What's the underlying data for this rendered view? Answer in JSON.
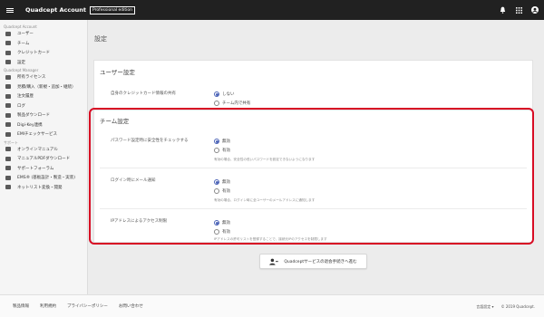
{
  "topbar": {
    "title": "Quadcept Account",
    "edition": "Professional edition",
    "icons": [
      "menu-icon",
      "bell-icon",
      "apps-grid-icon",
      "account-icon"
    ]
  },
  "sidebar": {
    "sections": [
      {
        "title": "Quadcept Account",
        "items": [
          {
            "label": "ユーザー",
            "icon": "users-icon"
          },
          {
            "label": "チーム",
            "icon": "team-icon"
          },
          {
            "label": "クレジットカード",
            "icon": "credit-card-icon"
          },
          {
            "label": "設定",
            "icon": "gear-icon"
          }
        ]
      },
      {
        "title": "Quadcept Manager",
        "items": [
          {
            "label": "所有ライセンス",
            "icon": "license-icon"
          },
          {
            "label": "見積/購入（新規・追加・継続）",
            "icon": "cart-icon"
          },
          {
            "label": "注文履歴",
            "icon": "history-icon"
          },
          {
            "label": "ログ",
            "icon": "chart-icon"
          },
          {
            "label": "製品ダウンロード",
            "icon": "cloud-download-icon"
          },
          {
            "label": "Digi-Key連携",
            "icon": "cart-icon"
          },
          {
            "label": "EMIチェックサービス",
            "icon": "emi-icon"
          }
        ]
      },
      {
        "title": "サポート",
        "items": [
          {
            "label": "オンラインマニュアル",
            "icon": "book-icon"
          },
          {
            "label": "マニュアルPDFダウンロード",
            "icon": "pdf-icon"
          },
          {
            "label": "サポートフォーラム",
            "icon": "forum-icon"
          },
          {
            "label": "EMS® (基板設計・製造・実装)",
            "icon": "ems-icon"
          },
          {
            "label": "ネットリスト変換・開発",
            "icon": "netlist-icon"
          }
        ]
      }
    ]
  },
  "main": {
    "page_title": "設定",
    "user_settings": {
      "title": "ユーザー設定",
      "rows": [
        {
          "label": "自身のクレジットカード情報の共有",
          "options": [
            {
              "label": "しない",
              "selected": true
            },
            {
              "label": "チーム内で共有",
              "selected": false
            }
          ]
        }
      ]
    },
    "team_settings": {
      "title": "チーム設定",
      "rows": [
        {
          "label": "パスワード設定時に安全性をチェックする",
          "options": [
            {
              "label": "無効",
              "selected": true
            },
            {
              "label": "有効",
              "selected": false
            }
          ],
          "hint": "有効の場合、安全性の低いパスワードを設定できないようになります"
        },
        {
          "label": "ログイン時にメール通知",
          "options": [
            {
              "label": "無効",
              "selected": true
            },
            {
              "label": "有効",
              "selected": false
            }
          ],
          "hint": "有効の場合、ログイン時に全ユーザーのメールアドレスに通知します"
        },
        {
          "label": "IPアドレスによるアクセス制限",
          "options": [
            {
              "label": "無効",
              "selected": true
            },
            {
              "label": "有効",
              "selected": false
            }
          ],
          "hint": "IPアドレスの許可リストを登録することで、接続元IPのアクセスを制限します"
        }
      ]
    },
    "proceed_button": "Quadceptサービスの退会手続きへ進む",
    "highlight_color": "#d80c24",
    "accent_color": "#4b63b7"
  },
  "footer": {
    "links": [
      "製品情報",
      "利用規約",
      "プライバシーポリシー",
      "お問い合わせ"
    ],
    "language": "言語設定",
    "copyright": "© 2019 Quadcept."
  }
}
